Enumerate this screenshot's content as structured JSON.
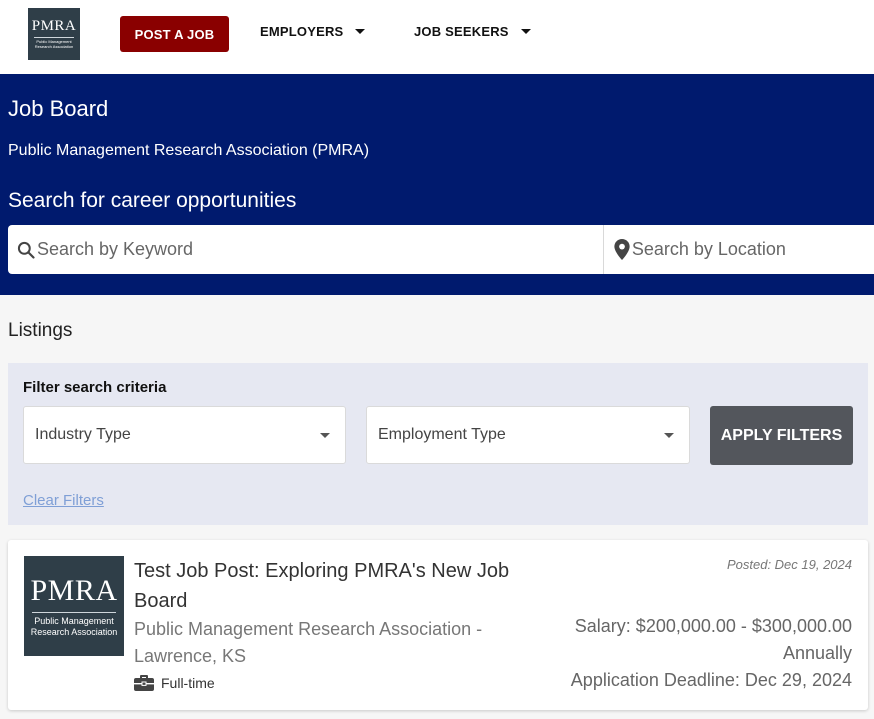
{
  "nav": {
    "logo": {
      "text": "PMRA",
      "subtext": "Public Management Research Association"
    },
    "post_job_label": "POST A JOB",
    "employers_label": "EMPLOYERS",
    "job_seekers_label": "JOB SEEKERS"
  },
  "hero": {
    "title": "Job Board",
    "org": "Public Management Research Association (PMRA)",
    "search_title": "Search for career opportunities",
    "keyword_placeholder": "Search by Keyword",
    "location_placeholder": "Search by Location"
  },
  "listings": {
    "title": "Listings",
    "filters": {
      "title": "Filter search criteria",
      "industry_type": "Industry Type",
      "employment_type": "Employment Type",
      "apply_label": "APPLY FILTERS",
      "clear_label": "Clear Filters"
    },
    "jobs": [
      {
        "logo_text": "PMRA",
        "logo_subtext": "Public Management Research Association",
        "title": "Test Job Post: Exploring PMRA's New Job Board",
        "company": "Public Management Research Association - Lawrence, KS",
        "employment_type": "Full-time",
        "posted": "Posted: Dec 19, 2024",
        "salary": "Salary: $200,000.00 - $300,000.00 Annually",
        "deadline": "Application Deadline: Dec 29, 2024"
      }
    ]
  },
  "colors": {
    "hero_bg": "#001a6e",
    "post_button": "#8a0000",
    "apply_button": "#53565c",
    "filter_panel": "#e6e8f2",
    "link": "#7f9fd6",
    "logo_bg": "#2f3e48"
  },
  "icons": {
    "search": "search-icon",
    "location": "location-pin-icon",
    "briefcase": "briefcase-icon",
    "dropdown": "chevron-down-icon"
  }
}
